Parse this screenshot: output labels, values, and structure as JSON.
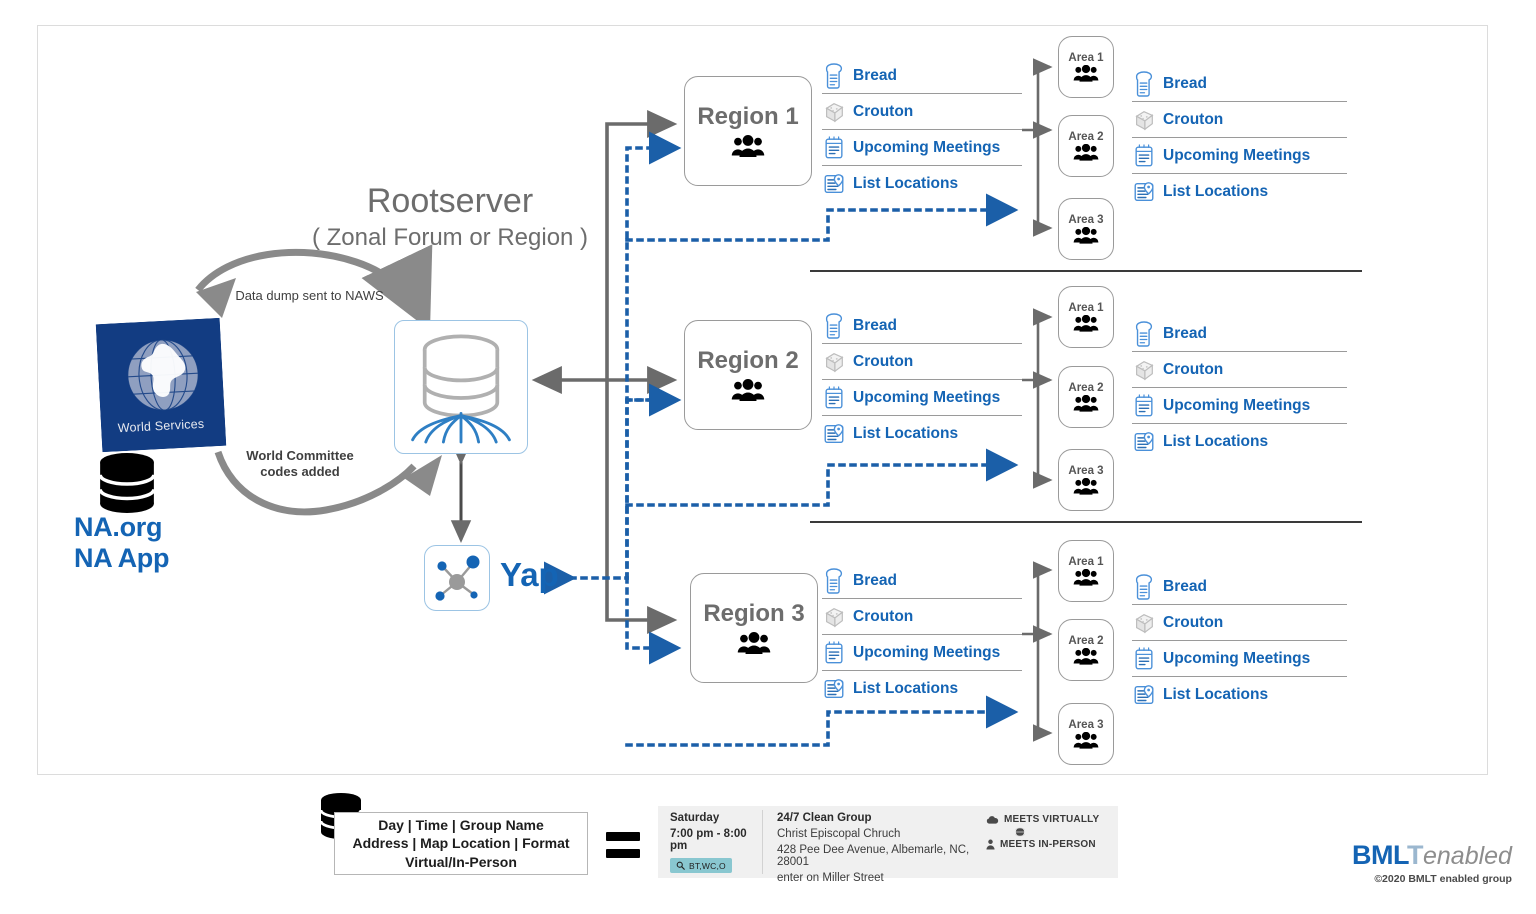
{
  "diagram": {
    "rootserver": {
      "title": "Rootserver",
      "subtitle": "( Zonal Forum or Region )",
      "cycle_label_top": "Data dump sent to NAWS",
      "cycle_label_bottom": "World Committee\ncodes added",
      "db_icon": "database-icon"
    },
    "world_services": {
      "stamp_label": "World Services",
      "globe_icon": "globe-icon",
      "db_icon": "database-icon",
      "links": "NA.org\nNA App",
      "link_line1": "NA.org",
      "link_line2": "NA App"
    },
    "yap": {
      "label": "Yap",
      "icon": "network-nodes-icon"
    },
    "service_labels": [
      {
        "icon": "bread-icon",
        "label": "Bread"
      },
      {
        "icon": "crouton-icon",
        "label": "Crouton"
      },
      {
        "icon": "calendar-list-icon",
        "label": "Upcoming Meetings"
      },
      {
        "icon": "list-map-pin-icon",
        "label": "List Locations"
      }
    ],
    "regions": [
      {
        "name": "Region 1",
        "icon": "people-group-icon",
        "services": [
          {
            "icon": "bread-icon",
            "label": "Bread"
          },
          {
            "icon": "crouton-icon",
            "label": "Crouton"
          },
          {
            "icon": "calendar-list-icon",
            "label": "Upcoming Meetings"
          },
          {
            "icon": "list-map-pin-icon",
            "label": "List Locations"
          }
        ],
        "areas": [
          {
            "name": "Area 1",
            "icon": "people-group-icon"
          },
          {
            "name": "Area 2",
            "icon": "people-group-icon"
          },
          {
            "name": "Area 3",
            "icon": "people-group-icon"
          }
        ],
        "area_services": [
          {
            "icon": "bread-icon",
            "label": "Bread"
          },
          {
            "icon": "crouton-icon",
            "label": "Crouton"
          },
          {
            "icon": "calendar-list-icon",
            "label": "Upcoming Meetings"
          },
          {
            "icon": "list-map-pin-icon",
            "label": "List Locations"
          }
        ]
      },
      {
        "name": "Region 2",
        "icon": "people-group-icon",
        "services": [
          {
            "icon": "bread-icon",
            "label": "Bread"
          },
          {
            "icon": "crouton-icon",
            "label": "Crouton"
          },
          {
            "icon": "calendar-list-icon",
            "label": "Upcoming Meetings"
          },
          {
            "icon": "list-map-pin-icon",
            "label": "List Locations"
          }
        ],
        "areas": [
          {
            "name": "Area 1",
            "icon": "people-group-icon"
          },
          {
            "name": "Area 2",
            "icon": "people-group-icon"
          },
          {
            "name": "Area 3",
            "icon": "people-group-icon"
          }
        ],
        "area_services": [
          {
            "icon": "bread-icon",
            "label": "Bread"
          },
          {
            "icon": "crouton-icon",
            "label": "Crouton"
          },
          {
            "icon": "calendar-list-icon",
            "label": "Upcoming Meetings"
          },
          {
            "icon": "list-map-pin-icon",
            "label": "List Locations"
          }
        ]
      },
      {
        "name": "Region 3",
        "icon": "people-group-icon",
        "services": [
          {
            "icon": "bread-icon",
            "label": "Bread"
          },
          {
            "icon": "crouton-icon",
            "label": "Crouton"
          },
          {
            "icon": "calendar-list-icon",
            "label": "Upcoming Meetings"
          },
          {
            "icon": "list-map-pin-icon",
            "label": "List Locations"
          }
        ],
        "areas": [
          {
            "name": "Area 1",
            "icon": "people-group-icon"
          },
          {
            "name": "Area 2",
            "icon": "people-group-icon"
          },
          {
            "name": "Area 3",
            "icon": "people-group-icon"
          }
        ],
        "area_services": [
          {
            "icon": "bread-icon",
            "label": "Bread"
          },
          {
            "icon": "crouton-icon",
            "label": "Crouton"
          },
          {
            "icon": "calendar-list-icon",
            "label": "Upcoming Meetings"
          },
          {
            "icon": "list-map-pin-icon",
            "label": "List Locations"
          }
        ]
      }
    ]
  },
  "legend": {
    "db_icon": "database-icon",
    "fields_line1": "Day | Time | Group Name",
    "fields_line2": "Address | Map Location | Format",
    "fields_line3": "Virtual/In-Person",
    "equals": "=",
    "meeting": {
      "day": "Saturday",
      "time": "7:00 pm - 8:00 pm",
      "badge_icon": "search-icon",
      "badge_text": "BT,WC,O",
      "group_name": "24/7 Clean Group",
      "venue": "Christ Episcopal Chruch",
      "address": "428 Pee Dee Avenue, Albemarle, NC, 28001",
      "directions": "enter on Miller Street",
      "flag_virtual_icon": "cloud-icon",
      "flag_virtual": "MEETS VIRTUALLY",
      "flag_mid_icon": "globe-small-icon",
      "flag_inperson_icon": "person-icon",
      "flag_inperson": "MEETS IN-PERSON"
    }
  },
  "branding": {
    "logo_bml": "BML",
    "logo_t": "T",
    "logo_enabled": "enabled",
    "copyright": "©2020 BMLT enabled group"
  },
  "colors": {
    "brand_blue": "#1464b4",
    "stamp_navy": "#123c82",
    "gray_text": "#6d6d6d",
    "line_gray": "#6b6b6b",
    "dotted_blue": "#1464b4",
    "badge_teal": "#89c7d0",
    "card_bg": "#f0f0f0"
  }
}
